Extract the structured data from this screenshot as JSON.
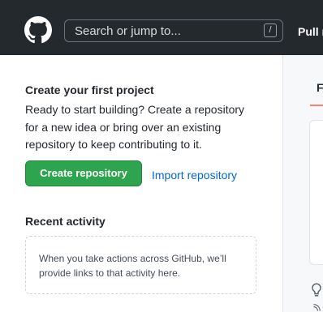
{
  "header": {
    "search_placeholder": "Search or jump to...",
    "search_shortcut": "/",
    "nav_item": "Pull r"
  },
  "project": {
    "title": "Create your first project",
    "description": "Ready to start building? Create a repository for a new idea or bring over an existing repository to keep contributing to it.",
    "create_button": "Create repository",
    "import_link": "Import repository"
  },
  "recent": {
    "title": "Recent activity",
    "empty_text": "When you take actions across GitHub, we’ll provide links to that activity here."
  },
  "sidebar": {
    "tab_label": "Fo"
  },
  "colors": {
    "header_bg": "#24292e",
    "primary_button": "#2ea44f",
    "link": "#0366d6",
    "tab_underline": "#f9826c"
  }
}
